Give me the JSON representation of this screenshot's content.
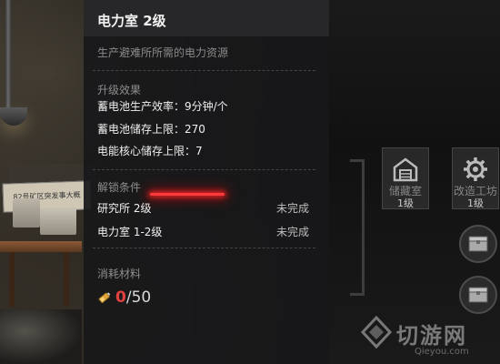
{
  "panel": {
    "title": "电力室 2级",
    "subtitle": "生产避难所所需的电力资源",
    "upgrade": {
      "heading": "升级效果",
      "lines": [
        "蓄电池生产效率：9分钟/个",
        "蓄电池储存上限：270",
        "电能核心储存上限：7"
      ]
    },
    "unlock": {
      "heading": "解锁条件",
      "conditions": [
        {
          "name": "研究所 2级",
          "status": "未完成"
        },
        {
          "name": "电力室 1-2级",
          "status": "未完成"
        }
      ]
    },
    "materials": {
      "heading": "消耗材料",
      "have": "0",
      "need": "/50",
      "icon": "battery-material-icon"
    }
  },
  "background": {
    "wall_sign": "82号矿区突发事大概"
  },
  "side": {
    "tiles": [
      {
        "name": "储藏室",
        "level": "1级",
        "icon": "storage-building-icon"
      },
      {
        "name": "改造工坊",
        "level": "1级",
        "icon": "gear-building-icon"
      }
    ],
    "crates": [
      "crate-icon",
      "crate-icon"
    ]
  },
  "watermark": {
    "text": "切游网",
    "sub": "Qieyou.com"
  },
  "colors": {
    "accent_red": "#e34040",
    "panel_bg": "#18181a"
  }
}
